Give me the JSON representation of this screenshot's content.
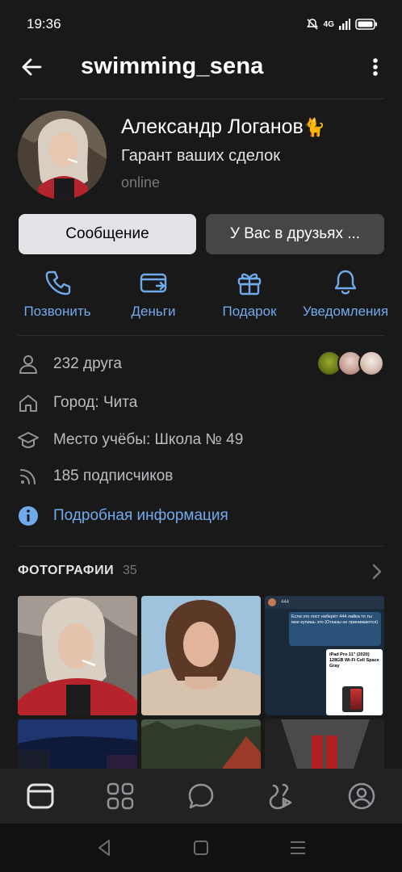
{
  "status_bar": {
    "time": "19:36",
    "network": "4G"
  },
  "header": {
    "title": "swimming_sena",
    "back_icon": "arrow-left-icon",
    "more_icon": "more-vertical-icon"
  },
  "profile": {
    "name": "Александр Логанов",
    "emoji": "🐈",
    "status": "Гарант ваших сделок",
    "online": "online"
  },
  "buttons": {
    "message": "Сообщение",
    "friends": "У Вас в друзьях ..."
  },
  "actions": [
    {
      "label": "Позвонить",
      "icon": "phone-icon"
    },
    {
      "label": "Деньги",
      "icon": "money-icon"
    },
    {
      "label": "Подарок",
      "icon": "gift-icon"
    },
    {
      "label": "Уведомления",
      "icon": "bell-icon"
    }
  ],
  "info": {
    "friends": "232 друга",
    "city": "Город: Чита",
    "education": "Место учёбы: Школа № 49",
    "followers": "185 подписчиков",
    "details": "Подробная информация"
  },
  "photos": {
    "title": "ФОТОГРАФИИ",
    "count": "35",
    "chat_preview": {
      "header": "444",
      "message": "Если это пост наберёт 444 лайка то ты мне купишь это (Отказы не принимаются)",
      "product": "iPad Pro 11\" (2020) 128GB Wi-Fi Cell Space Gray"
    }
  },
  "tabbar": [
    "home-icon",
    "services-icon",
    "messages-icon",
    "clips-icon",
    "profile-icon"
  ],
  "colors": {
    "background": "#19191a",
    "accent": "#71aaeb",
    "primary_button": "#e1e3e6",
    "secondary_button": "#454647"
  }
}
